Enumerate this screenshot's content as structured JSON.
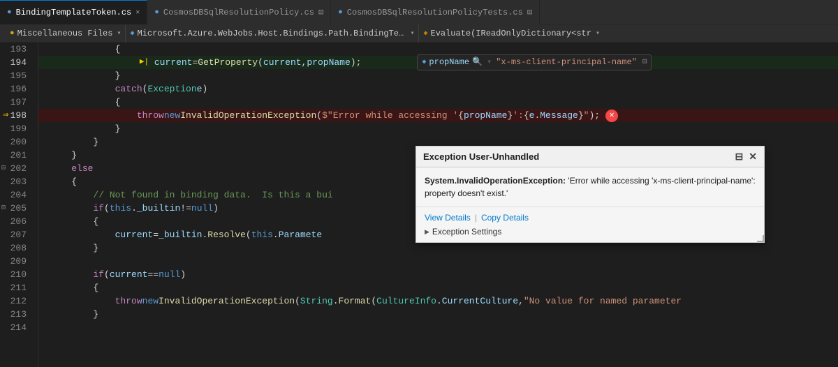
{
  "tabs": [
    {
      "id": "tab1",
      "label": "BindingTemplateToken.cs",
      "active": true,
      "dirty": false,
      "pinned": false
    },
    {
      "id": "tab2",
      "label": "CosmosDBSqlResolutionPolicy.cs",
      "active": false,
      "dirty": true,
      "pinned": false
    },
    {
      "id": "tab3",
      "label": "CosmosDBSqlResolutionPolicyTests.cs",
      "active": false,
      "dirty": true,
      "pinned": false
    }
  ],
  "breadcrumb": {
    "section1_icon": "●",
    "section1_label": "Miscellaneous Files",
    "section2_icon": "◆",
    "section2_label": "Microsoft.Azure.WebJobs.Host.Bindings.Path.BindingTemplate",
    "section3_icon": "▶",
    "section3_label": "Evaluate(IReadOnlyDictionary<str"
  },
  "code": {
    "lines": [
      {
        "num": "193",
        "content": "            {",
        "type": "plain"
      },
      {
        "num": "194",
        "content": "                ▶|  current = GetProperty(current, propName);",
        "type": "exec"
      },
      {
        "num": "195",
        "content": "            }",
        "type": "plain"
      },
      {
        "num": "196",
        "content": "            catch (Exception e)",
        "type": "catch"
      },
      {
        "num": "197",
        "content": "            {",
        "type": "plain"
      },
      {
        "num": "198",
        "content": "                throw new InvalidOperationException($\"Error while accessing '{propName}': {e.Message}\");",
        "type": "error"
      },
      {
        "num": "199",
        "content": "            }",
        "type": "plain"
      },
      {
        "num": "200",
        "content": "        }",
        "type": "plain"
      },
      {
        "num": "201",
        "content": "    }",
        "type": "plain"
      },
      {
        "num": "202",
        "content": "    else",
        "type": "else"
      },
      {
        "num": "203",
        "content": "    {",
        "type": "plain"
      },
      {
        "num": "204",
        "content": "        // Not found in binding data.  Is this a bui",
        "type": "comment"
      },
      {
        "num": "205",
        "content": "        if (this._builtin != null)",
        "type": "if"
      },
      {
        "num": "206",
        "content": "        {",
        "type": "plain"
      },
      {
        "num": "207",
        "content": "            current = _builtin.Resolve(this.Paramete",
        "type": "plain"
      },
      {
        "num": "208",
        "content": "        }",
        "type": "plain"
      },
      {
        "num": "209",
        "content": "",
        "type": "plain"
      },
      {
        "num": "210",
        "content": "        if (current == null)",
        "type": "if"
      },
      {
        "num": "211",
        "content": "        {",
        "type": "plain"
      },
      {
        "num": "212",
        "content": "            throw new InvalidOperationException(String.Format(CultureInfo.CurrentCulture, \"No value for named parameter",
        "type": "plain"
      },
      {
        "num": "213",
        "content": "        }",
        "type": "plain"
      },
      {
        "num": "214",
        "content": "",
        "type": "plain"
      }
    ]
  },
  "inline_tooltip": {
    "icon": "◆",
    "prop_label": "propName",
    "search_icon": "🔍",
    "value": "\"x-ms-client-principal-name\"",
    "pin_icon": "⊟"
  },
  "exception_popup": {
    "title": "Exception User-Unhandled",
    "pin_icon": "⊟",
    "close_icon": "✕",
    "exception_type": "System.InvalidOperationException:",
    "exception_message": " 'Error while accessing 'x-ms-client-principal-name': property doesn't exist.'",
    "view_details_label": "View Details",
    "copy_details_label": "Copy Details",
    "settings_label": "Exception Settings"
  },
  "colors": {
    "keyword_blue": "#569cd6",
    "keyword_purple": "#c586c0",
    "string_orange": "#ce9178",
    "comment_green": "#6a9955",
    "method_yellow": "#dcdcaa",
    "type_teal": "#4ec9b0",
    "param_lightblue": "#9cdcfe",
    "error_red": "#f44747",
    "accent_blue": "#007acc"
  }
}
